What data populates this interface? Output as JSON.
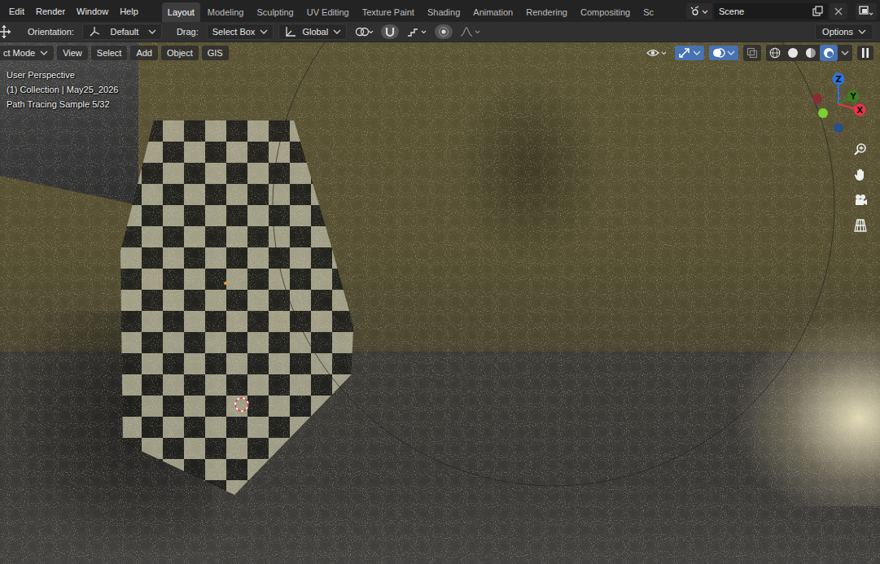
{
  "menu": [
    {
      "label": "Edit"
    },
    {
      "label": "Render"
    },
    {
      "label": "Window"
    },
    {
      "label": "Help"
    }
  ],
  "workspaces": [
    {
      "label": "Layout",
      "selected": true
    },
    {
      "label": "Modeling",
      "selected": false
    },
    {
      "label": "Sculpting",
      "selected": false
    },
    {
      "label": "UV Editing",
      "selected": false
    },
    {
      "label": "Texture Paint",
      "selected": false
    },
    {
      "label": "Shading",
      "selected": false
    },
    {
      "label": "Animation",
      "selected": false
    },
    {
      "label": "Rendering",
      "selected": false
    },
    {
      "label": "Compositing",
      "selected": false
    },
    {
      "label": "Sc",
      "selected": false
    }
  ],
  "scene": {
    "name": "Scene"
  },
  "tool_header": {
    "orientation_label": "Orientation:",
    "orientation": "Default",
    "drag_label": "Drag:",
    "drag": "Select Box",
    "transform_space": "Global",
    "options": "Options"
  },
  "viewport_header": {
    "mode": "ct Mode",
    "menus": [
      "View",
      "Select",
      "Add",
      "Object",
      "GIS"
    ],
    "toggles": [
      {
        "kind": "gizmo",
        "on": true
      },
      {
        "kind": "overlay",
        "on": true
      },
      {
        "kind": "xray",
        "on": false
      }
    ],
    "shading": [
      {
        "kind": "wireframe",
        "selected": false
      },
      {
        "kind": "solid",
        "selected": false
      },
      {
        "kind": "material",
        "selected": false
      },
      {
        "kind": "rendered",
        "selected": true
      }
    ]
  },
  "overlay_info": [
    "User Perspective",
    "(1) Collection | May25_2026",
    "Path Tracing Sample 5/32"
  ],
  "gizmo": {
    "axes": [
      {
        "label": "Z",
        "color": "#2f73e0",
        "negative_color": "#2a4f8a"
      },
      {
        "label": "Y",
        "color": "#3f7f1c",
        "negative_color": "#7bd12f"
      },
      {
        "label": "X",
        "color": "#e8334a",
        "negative_color": "#8a2c36"
      }
    ]
  }
}
